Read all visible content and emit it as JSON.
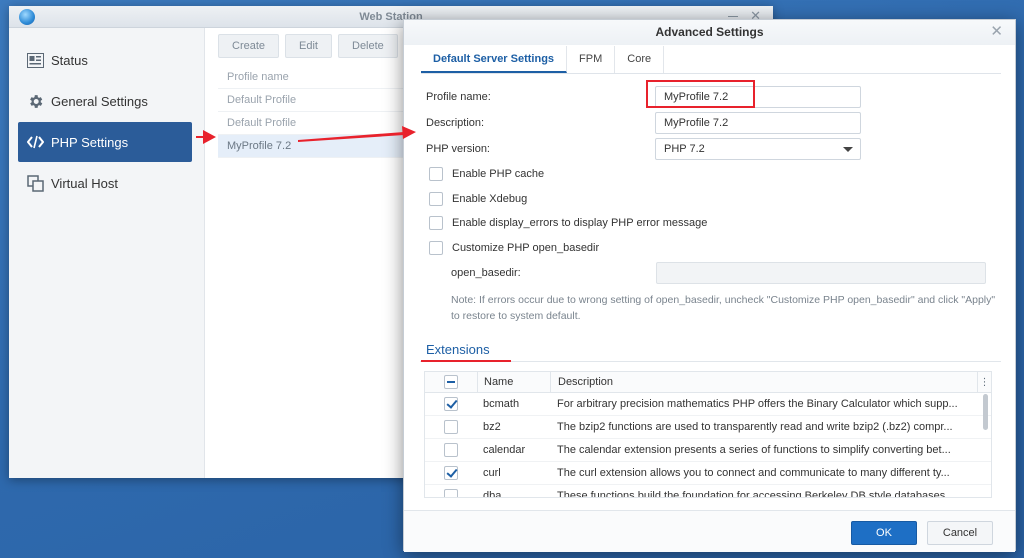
{
  "background_window": {
    "title": "Web Station",
    "sidebar": [
      {
        "label": "Status",
        "icon": "status-icon"
      },
      {
        "label": "General Settings",
        "icon": "gear-icon"
      },
      {
        "label": "PHP Settings",
        "icon": "code-icon",
        "active": true
      },
      {
        "label": "Virtual Host",
        "icon": "virtual-host-icon"
      }
    ],
    "toolbar": {
      "create": "Create",
      "edit": "Edit",
      "delete": "Delete"
    },
    "profile_list": {
      "header": "Profile name",
      "rows": [
        "Default Profile",
        "Default Profile",
        "MyProfile 7.2"
      ]
    }
  },
  "dialog": {
    "title": "Advanced Settings",
    "tabs": [
      "Default Server Settings",
      "FPM",
      "Core"
    ],
    "profile_name_label": "Profile name:",
    "profile_name_value": "MyProfile 7.2",
    "description_label": "Description:",
    "description_value": "MyProfile 7.2",
    "php_version_label": "PHP version:",
    "php_version_value": "PHP 7.2",
    "checkboxes": [
      "Enable PHP cache",
      "Enable Xdebug",
      "Enable display_errors to display PHP error message",
      "Customize PHP open_basedir"
    ],
    "open_basedir_label": "open_basedir:",
    "note": "Note: If errors occur due to wrong setting of open_basedir, uncheck \"Customize PHP open_basedir\" and click \"Apply\" to restore to system default.",
    "extensions": {
      "title": "Extensions",
      "columns": {
        "name": "Name",
        "description": "Description"
      },
      "rows": [
        {
          "name": "bcmath",
          "description": "For arbitrary precision mathematics PHP offers the Binary Calculator which supp...",
          "checked": true
        },
        {
          "name": "bz2",
          "description": "The bzip2 functions are used to transparently read and write bzip2 (.bz2) compr...",
          "checked": false
        },
        {
          "name": "calendar",
          "description": "The calendar extension presents a series of functions to simplify converting bet...",
          "checked": false
        },
        {
          "name": "curl",
          "description": "The curl extension allows you to connect and communicate to many different ty...",
          "checked": true
        },
        {
          "name": "dba",
          "description": "These functions build the foundation for accessing Berkeley DB style databases...",
          "checked": false
        }
      ]
    },
    "ok": "OK",
    "cancel": "Cancel"
  },
  "colors": {
    "accent": "#1d5fa5",
    "annotation": "#e8222c",
    "active_nav": "#2b5c99"
  }
}
